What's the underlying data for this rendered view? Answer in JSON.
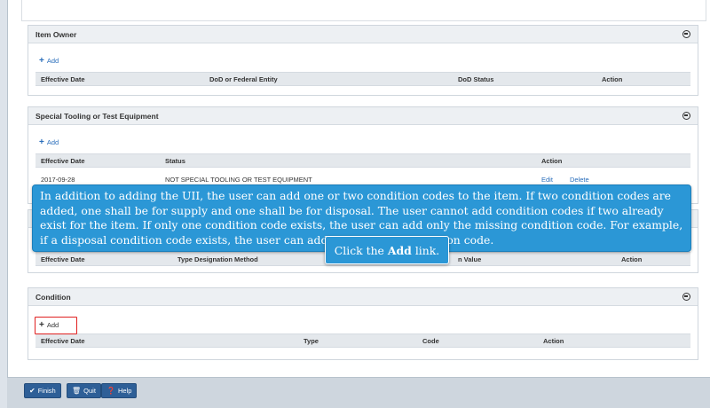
{
  "item_owner": {
    "title": "Item Owner",
    "add_label": "Add",
    "columns": [
      "Effective Date",
      "DoD or Federal Entity",
      "DoD Status",
      "Action"
    ]
  },
  "special_tooling": {
    "title": "Special Tooling or Test Equipment",
    "add_label": "Add",
    "columns": [
      "Effective Date",
      "Status",
      "Action"
    ],
    "row": {
      "date": "2017-09-28",
      "status": "NOT SPECIAL TOOLING OR TEST EQUIPMENT",
      "edit": "Edit",
      "delete": "Delete"
    }
  },
  "type_designation": {
    "columns": [
      "Effective Date",
      "Type Designation Method",
      "n Value",
      "Action"
    ]
  },
  "condition": {
    "title": "Condition",
    "add_label": "Add",
    "columns": [
      "Effective Date",
      "Type",
      "Code",
      "Action"
    ]
  },
  "tooltip": {
    "text": "In addition to adding the UII, the user can add one or two condition codes to the item. If two condition codes are added, one shall be for supply and one shall be for disposal. The user cannot add condition codes if two already exist for the item. If only one condition code exists, the user can add only the missing condition code. For example, if a disposal condition code exists, the user can add only a supply condition code.",
    "callout_prefix": "Click the",
    "callout_bold": "Add",
    "callout_suffix": "link."
  },
  "footer": {
    "finish": "Finish",
    "quit": "Quit",
    "help": "Help"
  },
  "colors": {
    "accent": "#2b97d6",
    "button": "#2e5f97",
    "highlight": "#e02020"
  }
}
